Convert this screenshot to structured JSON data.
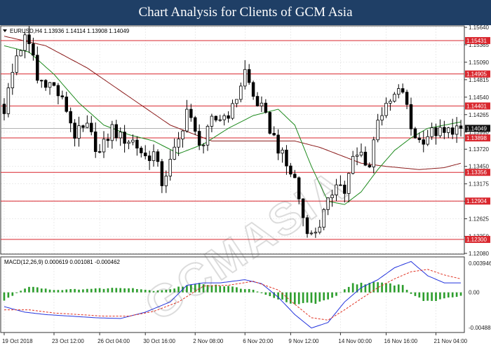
{
  "banner": {
    "title": "Chart Analysis for Clients of GCM Asia"
  },
  "chart_data": {
    "type": "candlestick",
    "symbol_header": "EURUSD,H4  1.13936 1.14114 1.13908 1.14049",
    "price_axis": {
      "ylim": [
        1.1208,
        1.1564
      ],
      "ticks": [
        1.1564,
        1.15365,
        1.1509,
        1.14815,
        1.1454,
        1.14265,
        1.1399,
        1.1372,
        1.1345,
        1.13175,
        1.129,
        1.12625,
        1.1235,
        1.1208
      ],
      "tick_labels": [
        "1.15640",
        "1.15365",
        "1.15090",
        "1.14815",
        "1.14540",
        "1.14265",
        "1.13990",
        "1.13720",
        "1.13450",
        "1.13175",
        "1.12900",
        "1.12625",
        "1.12350",
        "1.12080"
      ]
    },
    "x_axis": {
      "labels": [
        "19 Oct 2018",
        "23 Oct 12:00",
        "26 Oct 04:00",
        "30 Oct 16:00",
        "2 Nov 08:00",
        "6 Nov 20:00",
        "9 Nov 12:00",
        "14 Nov 00:00",
        "16 Nov 16:00",
        "21 Nov 04:00"
      ],
      "label_positions": [
        0,
        12,
        23,
        34,
        46,
        58,
        69,
        81,
        92,
        104
      ]
    },
    "levels": [
      {
        "value": 1.15431,
        "label": "1.15431"
      },
      {
        "value": 1.14905,
        "label": "1.14905"
      },
      {
        "value": 1.14401,
        "label": "1.14401"
      },
      {
        "value": 1.13898,
        "label": "1.13898"
      },
      {
        "value": 1.13356,
        "label": "1.13356"
      },
      {
        "value": 1.12904,
        "label": "1.12904"
      },
      {
        "value": 1.123,
        "label": "1.12300"
      }
    ],
    "current_price": {
      "value": 1.14049,
      "label": "1.14049"
    },
    "candle_count": 111,
    "close_path": [
      [
        0,
        1.1435
      ],
      [
        3,
        1.152
      ],
      [
        5,
        1.1545
      ],
      [
        7,
        1.152
      ],
      [
        8,
        1.148
      ],
      [
        10,
        1.148
      ],
      [
        12,
        1.147
      ],
      [
        15,
        1.1435
      ],
      [
        17,
        1.1395
      ],
      [
        20,
        1.1405
      ],
      [
        23,
        1.1365
      ],
      [
        26,
        1.1405
      ],
      [
        28,
        1.139
      ],
      [
        31,
        1.1385
      ],
      [
        34,
        1.136
      ],
      [
        36,
        1.1365
      ],
      [
        38,
        1.132
      ],
      [
        40,
        1.135
      ],
      [
        42,
        1.1385
      ],
      [
        44,
        1.1435
      ],
      [
        46,
        1.1395
      ],
      [
        48,
        1.138
      ],
      [
        50,
        1.1415
      ],
      [
        53,
        1.1425
      ],
      [
        55,
        1.1435
      ],
      [
        58,
        1.1495
      ],
      [
        60,
        1.1455
      ],
      [
        62,
        1.1435
      ],
      [
        64,
        1.1405
      ],
      [
        66,
        1.1375
      ],
      [
        68,
        1.1345
      ],
      [
        70,
        1.1325
      ],
      [
        72,
        1.1265
      ],
      [
        74,
        1.1235
      ],
      [
        76,
        1.1255
      ],
      [
        78,
        1.1285
      ],
      [
        80,
        1.1325
      ],
      [
        82,
        1.1305
      ],
      [
        84,
        1.1355
      ],
      [
        86,
        1.1365
      ],
      [
        88,
        1.1345
      ],
      [
        90,
        1.1425
      ],
      [
        92,
        1.1435
      ],
      [
        94,
        1.1455
      ],
      [
        96,
        1.1465
      ],
      [
        98,
        1.1405
      ],
      [
        100,
        1.1385
      ],
      [
        102,
        1.1395
      ],
      [
        104,
        1.14
      ],
      [
        106,
        1.1395
      ],
      [
        108,
        1.1405
      ],
      [
        110,
        1.14049
      ]
    ],
    "ma_fast_path": [
      [
        0,
        1.1535
      ],
      [
        6,
        1.1525
      ],
      [
        12,
        1.149
      ],
      [
        18,
        1.1445
      ],
      [
        24,
        1.141
      ],
      [
        30,
        1.1395
      ],
      [
        36,
        1.1385
      ],
      [
        42,
        1.1365
      ],
      [
        48,
        1.138
      ],
      [
        54,
        1.1405
      ],
      [
        60,
        1.1425
      ],
      [
        66,
        1.1435
      ],
      [
        70,
        1.141
      ],
      [
        74,
        1.1345
      ],
      [
        78,
        1.129
      ],
      [
        82,
        1.1285
      ],
      [
        86,
        1.1305
      ],
      [
        90,
        1.134
      ],
      [
        94,
        1.137
      ],
      [
        98,
        1.139
      ],
      [
        102,
        1.1405
      ],
      [
        106,
        1.141
      ],
      [
        110,
        1.1415
      ]
    ],
    "ma_slow_path": [
      [
        0,
        1.155
      ],
      [
        10,
        1.1535
      ],
      [
        20,
        1.15
      ],
      [
        30,
        1.1455
      ],
      [
        40,
        1.141
      ],
      [
        50,
        1.1385
      ],
      [
        60,
        1.1385
      ],
      [
        70,
        1.1385
      ],
      [
        76,
        1.1375
      ],
      [
        82,
        1.136
      ],
      [
        86,
        1.135
      ],
      [
        92,
        1.1345
      ],
      [
        100,
        1.134
      ],
      [
        106,
        1.1343
      ],
      [
        110,
        1.135
      ]
    ],
    "macd": {
      "header": "MACD(12,26,9) 0.000619 0.001081 -0.000462",
      "ylim": [
        -0.004888,
        0.003946
      ],
      "tick_labels": [
        "0.003946",
        "0.00",
        "-0.004888"
      ],
      "histogram_path": [
        [
          0,
          -0.001
        ],
        [
          6,
          0.0008
        ],
        [
          12,
          0.0003
        ],
        [
          18,
          0.0004
        ],
        [
          24,
          0.0005
        ],
        [
          30,
          0.0006
        ],
        [
          36,
          0.0002
        ],
        [
          40,
          0.0004
        ],
        [
          44,
          0.0009
        ],
        [
          48,
          0.0011
        ],
        [
          52,
          0.0009
        ],
        [
          56,
          0.0006
        ],
        [
          60,
          0.0003
        ],
        [
          64,
          -0.0005
        ],
        [
          68,
          -0.0012
        ],
        [
          72,
          -0.0015
        ],
        [
          76,
          -0.0012
        ],
        [
          80,
          -0.0004
        ],
        [
          84,
          0.0011
        ],
        [
          88,
          0.0012
        ],
        [
          92,
          0.0011
        ],
        [
          96,
          0.0009
        ],
        [
          98,
          -0.0002
        ],
        [
          102,
          -0.0012
        ],
        [
          106,
          -0.0008
        ],
        [
          110,
          -0.0005
        ]
      ],
      "macd_path": [
        [
          0,
          -0.0018
        ],
        [
          5,
          -0.0025
        ],
        [
          10,
          -0.0028
        ],
        [
          16,
          -0.003
        ],
        [
          22,
          -0.0032
        ],
        [
          28,
          -0.0033
        ],
        [
          34,
          -0.0025
        ],
        [
          40,
          -0.0012
        ],
        [
          44,
          0.0009
        ],
        [
          48,
          0.0012
        ],
        [
          52,
          0.0012
        ],
        [
          58,
          0.0016
        ],
        [
          62,
          0.0011
        ],
        [
          66,
          -0.0006
        ],
        [
          70,
          -0.0028
        ],
        [
          74,
          -0.0045
        ],
        [
          78,
          -0.0038
        ],
        [
          82,
          -0.0012
        ],
        [
          86,
          0.0006
        ],
        [
          90,
          0.0016
        ],
        [
          94,
          0.0031
        ],
        [
          98,
          0.0039
        ],
        [
          102,
          0.0021
        ],
        [
          106,
          0.0012
        ],
        [
          110,
          0.0012
        ]
      ],
      "signal_path": [
        [
          0,
          -0.0022
        ],
        [
          6,
          -0.0022
        ],
        [
          12,
          -0.0026
        ],
        [
          18,
          -0.0028
        ],
        [
          24,
          -0.003
        ],
        [
          30,
          -0.003
        ],
        [
          36,
          -0.0024
        ],
        [
          42,
          -0.0012
        ],
        [
          48,
          0.0008
        ],
        [
          54,
          0.0009
        ],
        [
          60,
          0.0014
        ],
        [
          66,
          0.0003
        ],
        [
          70,
          -0.0015
        ],
        [
          74,
          -0.0032
        ],
        [
          78,
          -0.0035
        ],
        [
          82,
          -0.0022
        ],
        [
          86,
          -0.0008
        ],
        [
          90,
          0.0006
        ],
        [
          94,
          0.0017
        ],
        [
          98,
          0.0026
        ],
        [
          102,
          0.0029
        ],
        [
          106,
          0.0022
        ],
        [
          110,
          0.0017
        ]
      ]
    }
  }
}
